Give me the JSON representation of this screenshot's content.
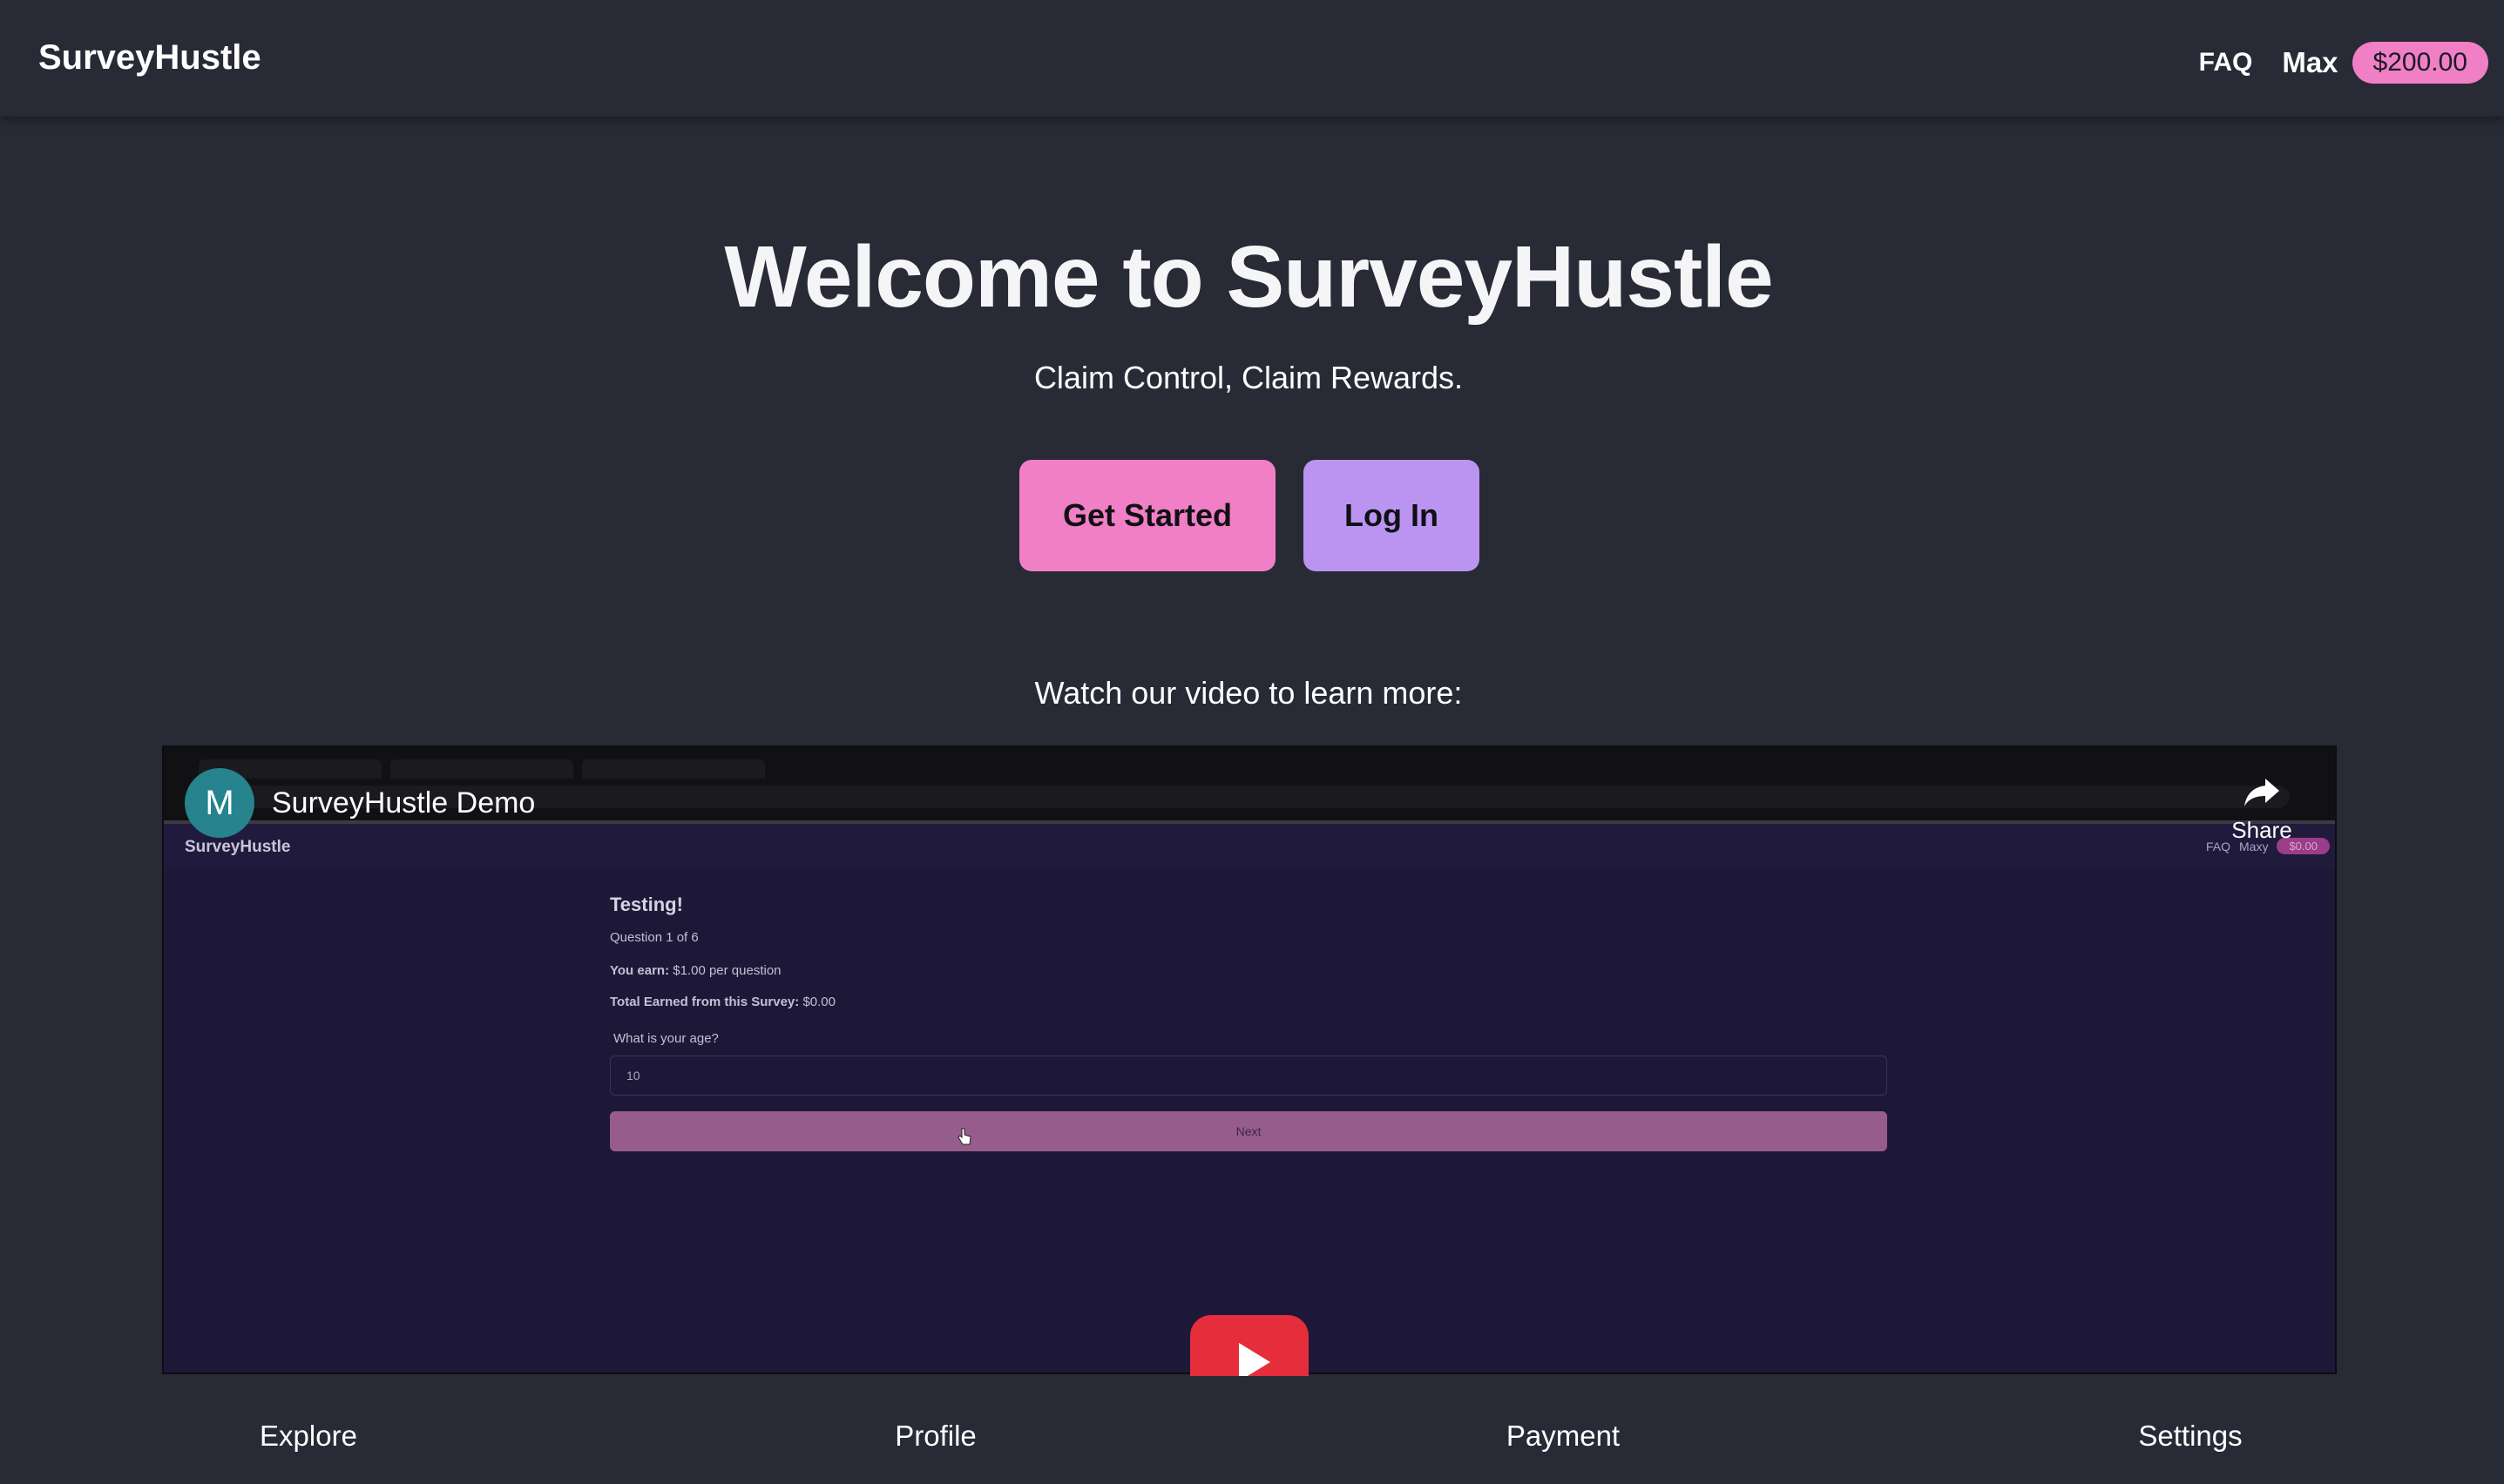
{
  "header": {
    "brand": "SurveyHustle",
    "faq": "FAQ",
    "username": "Max",
    "balance": "$200.00"
  },
  "hero": {
    "title": "Welcome to SurveyHustle",
    "subtitle": "Claim Control, Claim Rewards.",
    "get_started": "Get Started",
    "log_in": "Log In",
    "video_caption": "Watch our video to learn more:"
  },
  "video": {
    "channel_initial": "M",
    "title": "SurveyHustle Demo",
    "share": "Share",
    "preview": {
      "brand": "SurveyHustle",
      "faq": "FAQ",
      "user": "Maxy",
      "balance": "$0.00",
      "survey_title": "Testing!",
      "question_counter": "Question 1 of 6",
      "earn_label": "You earn:",
      "earn_value": "$1.00 per question",
      "total_label": "Total Earned from this Survey:",
      "total_value": "$0.00",
      "question": "What is your age?",
      "answer": "10",
      "next": "Next"
    }
  },
  "bottom_nav": {
    "explore": "Explore",
    "profile": "Profile",
    "payment": "Payment",
    "settings": "Settings"
  },
  "colors": {
    "background": "#282a36",
    "pink": "#f07fc6",
    "purple": "#bb94f2",
    "play_red": "#e52d3c"
  }
}
